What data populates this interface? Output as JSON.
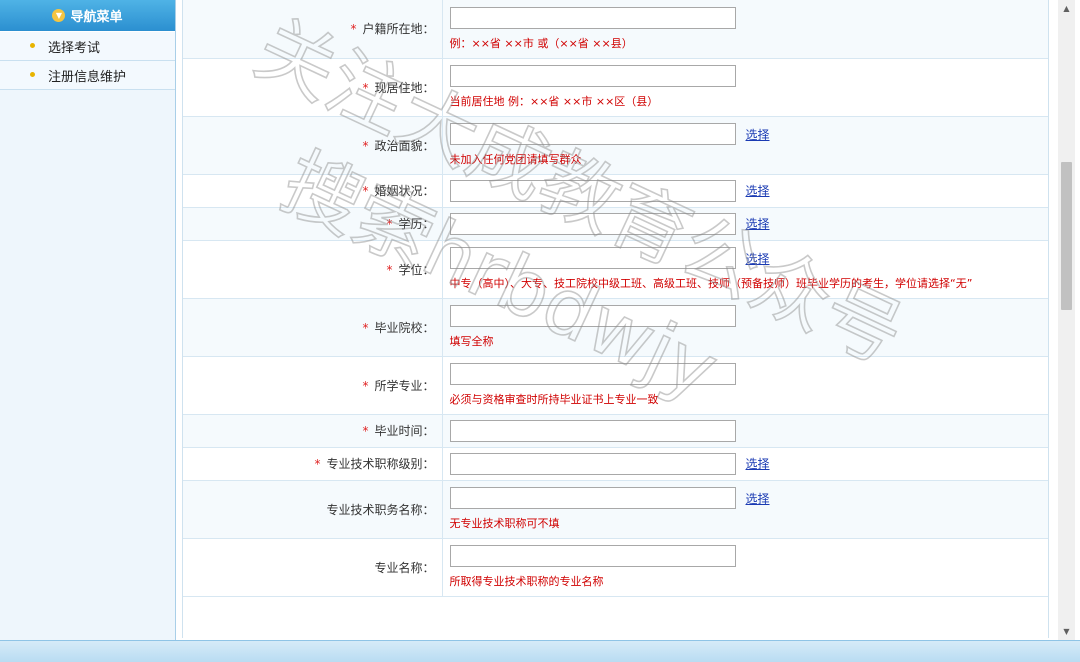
{
  "sidebar": {
    "header": "导航菜单",
    "items": [
      {
        "label": "选择考试"
      },
      {
        "label": "注册信息维护"
      }
    ]
  },
  "form": {
    "rows": [
      {
        "label": "户籍所在地：",
        "required": true,
        "picker": "",
        "hint": "例：××省 ××市 或（××省 ××县）"
      },
      {
        "label": "现居住地：",
        "required": true,
        "picker": "",
        "hint": "当前居住地 例：××省 ××市 ××区（县）"
      },
      {
        "label": "政治面貌：",
        "required": true,
        "picker": "选择",
        "hint": "未加入任何党团请填写群众"
      },
      {
        "label": "婚姻状况：",
        "required": true,
        "picker": "选择",
        "hint": ""
      },
      {
        "label": "学历：",
        "required": true,
        "picker": "选择",
        "hint": ""
      },
      {
        "label": "学位：",
        "required": true,
        "picker": "选择",
        "hint": "中专（高中）、大专、技工院校中级工班、高级工班、技师（预备技师）班毕业学历的考生，学位请选择“无”"
      },
      {
        "label": "毕业院校：",
        "required": true,
        "picker": "",
        "hint": "填写全称"
      },
      {
        "label": "所学专业：",
        "required": true,
        "picker": "",
        "hint": "必须与资格审查时所持毕业证书上专业一致"
      },
      {
        "label": "毕业时间：",
        "required": true,
        "picker": "",
        "hint": ""
      },
      {
        "label": "专业技术职称级别：",
        "required": true,
        "picker": "选择",
        "hint": ""
      },
      {
        "label": "专业技术职务名称：",
        "required": false,
        "picker": "选择",
        "hint": "无专业技术职称可不填"
      },
      {
        "label": "专业名称：",
        "required": false,
        "picker": "",
        "hint": "所取得专业技术职称的专业名称"
      }
    ]
  },
  "watermark": {
    "line1": "关注大成教育公众号",
    "line2": "搜索hrbdwjy",
    "color": "#8a8a8a"
  },
  "scrollbar": {
    "up_glyph": "▲",
    "down_glyph": "▼"
  },
  "colors": {
    "accent": "#2b8fd0",
    "hint": "#d00000",
    "link": "#1a3ab3",
    "required": "#e02020"
  }
}
